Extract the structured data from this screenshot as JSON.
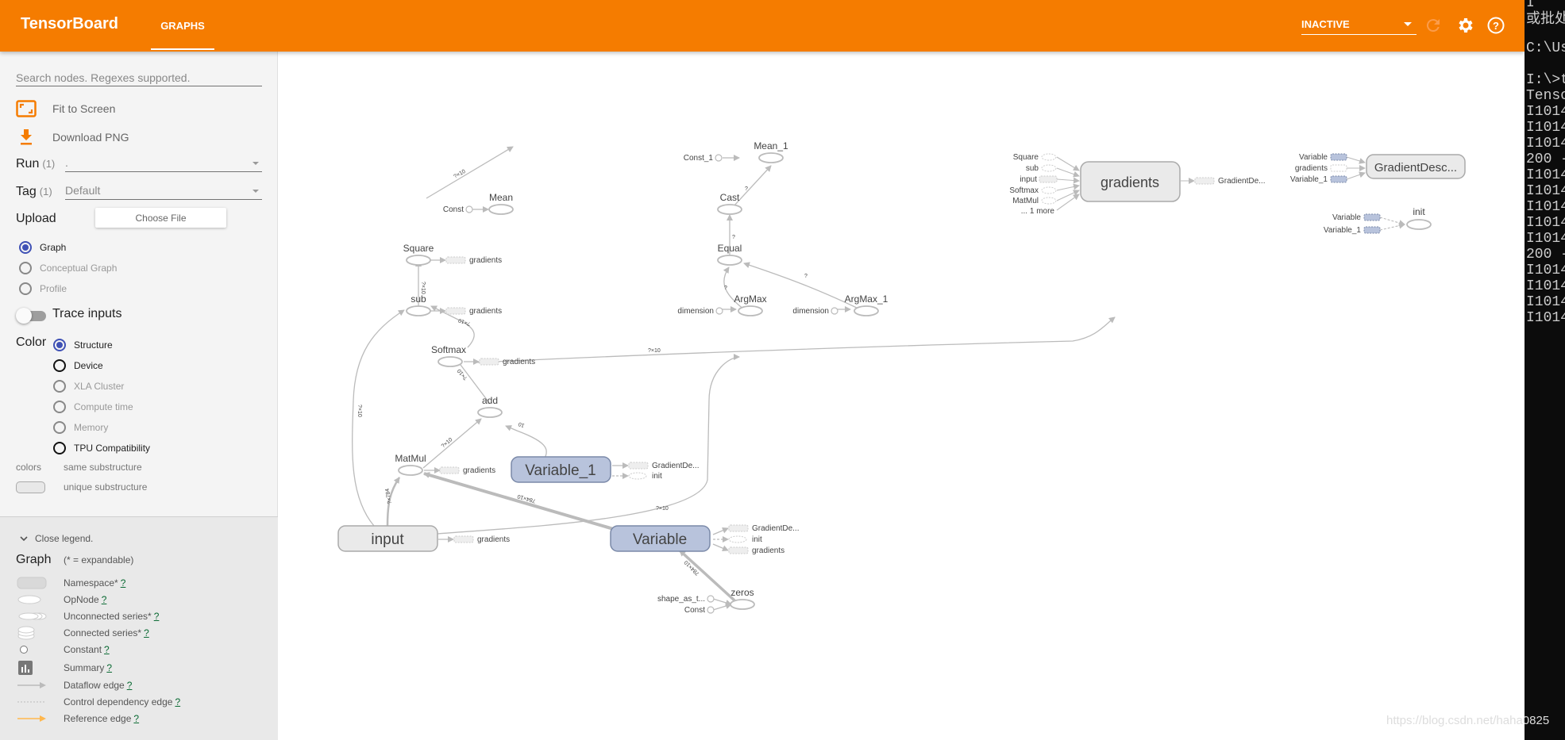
{
  "header": {
    "brand": "TensorBoard",
    "tabs": [
      {
        "label": "GRAPHS",
        "active": true
      }
    ],
    "run_status": "INACTIVE",
    "accent_color": "#f57c00"
  },
  "sidebar": {
    "search_placeholder": "Search nodes. Regexes supported.",
    "fit_to_screen": "Fit to Screen",
    "download_png": "Download PNG",
    "run": {
      "label": "Run",
      "count": "(1)",
      "value": "."
    },
    "tag": {
      "label": "Tag",
      "count": "(1)",
      "value": "Default"
    },
    "upload": {
      "label": "Upload",
      "button": "Choose File"
    },
    "graph_type": [
      {
        "label": "Graph",
        "selected": true
      },
      {
        "label": "Conceptual Graph",
        "selected": false
      },
      {
        "label": "Profile",
        "selected": false
      }
    ],
    "trace_inputs": {
      "label": "Trace inputs",
      "enabled": false
    },
    "color": {
      "label": "Color",
      "options": [
        {
          "label": "Structure",
          "selected": true
        },
        {
          "label": "Device",
          "selected": false
        },
        {
          "label": "XLA Cluster",
          "selected": false
        },
        {
          "label": "Compute time",
          "selected": false
        },
        {
          "label": "Memory",
          "selected": false
        },
        {
          "label": "TPU Compatibility",
          "selected": false
        }
      ]
    },
    "colors_label": "colors",
    "same_substructure": "same substructure",
    "unique_substructure": "unique substructure"
  },
  "legend": {
    "close": "Close legend.",
    "title": "Graph",
    "subtitle": "(* = expandable)",
    "help": "?",
    "items": [
      {
        "label": "Namespace*"
      },
      {
        "label": "OpNode"
      },
      {
        "label": "Unconnected series*"
      },
      {
        "label": "Connected series*"
      },
      {
        "label": "Constant"
      },
      {
        "label": "Summary"
      },
      {
        "label": "Dataflow edge"
      },
      {
        "label": "Control dependency edge"
      },
      {
        "label": "Reference edge"
      }
    ]
  },
  "graph": {
    "nodes": {
      "mean": "Mean",
      "const": "Const",
      "square": "Square",
      "sub": "sub",
      "softmax": "Softmax",
      "add": "add",
      "matmul": "MatMul",
      "input": "input",
      "variable_1": "Variable_1",
      "variable": "Variable",
      "zeros": "zeros",
      "shape_as_t": "shape_as_t...",
      "zeros_const": "Const",
      "mean_1": "Mean_1",
      "const_1": "Const_1",
      "cast": "Cast",
      "equal": "Equal",
      "argmax": "ArgMax",
      "argmax_1": "ArgMax_1",
      "dimension": "dimension",
      "gradients": "gradients",
      "gradient_desc": "GradientDesc...",
      "init": "init"
    },
    "aux_labels": {
      "gradients": "gradients",
      "gradient_de": "GradientDe...",
      "init": "init"
    },
    "gradients_inputs": [
      "Square",
      "sub",
      "input",
      "Softmax",
      "MatMul",
      "... 1 more"
    ],
    "gradient_desc_inputs": [
      "Variable",
      "gradients",
      "Variable_1"
    ],
    "init_inputs": [
      "Variable",
      "Variable_1"
    ],
    "edge_labels": {
      "square_mean": "?×10",
      "sub_square": "?×10",
      "softmax_sub": "?×10",
      "add_softmax": "?×10",
      "matmul_add": "?×10",
      "var1_add": "10",
      "input_matmul": "?×784",
      "var_matmul": "784×10",
      "input_sub": "?×10",
      "input_argmax": "?×10",
      "softmax_argmax1": "?×10",
      "zeros_var": "784×10",
      "cast_mean1": "?",
      "equal_cast": "?",
      "argmax_equal": "?",
      "argmax1_equal": "?"
    }
  },
  "terminal": {
    "lines": [
      "I  ",
      "或批处",
      "",
      "C:\\Us",
      "",
      "I:\\>t",
      "Tenso",
      "I1014",
      "I1014",
      "I1014",
      "200 -",
      "I1014",
      "I1014",
      "I1014",
      "I1014",
      "I1014",
      "200 -",
      "I1014",
      "I1014",
      "I1014",
      "I1014"
    ]
  },
  "watermark": "https://blog.csdn.net/haha0825"
}
